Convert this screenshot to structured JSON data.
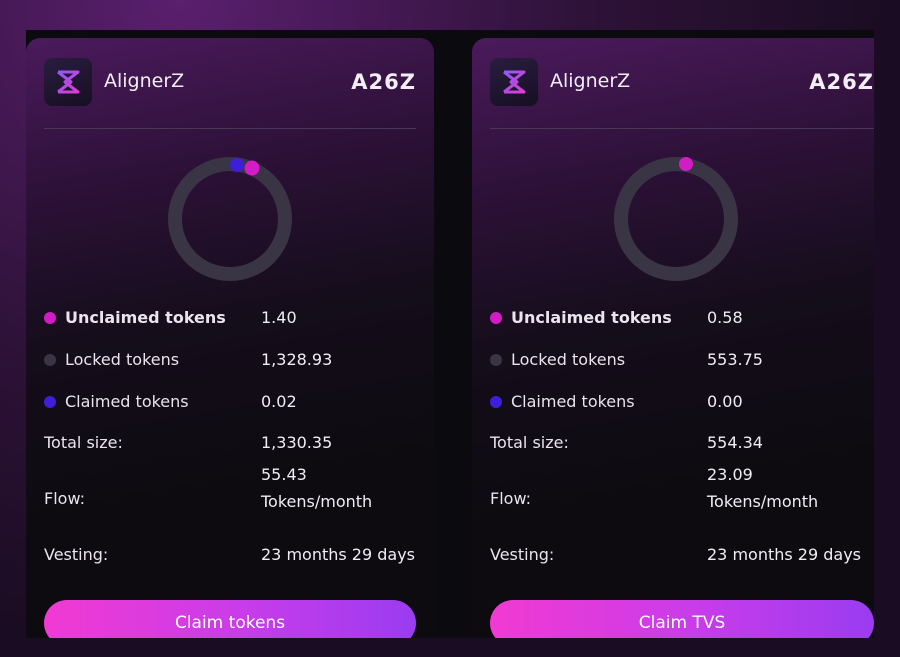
{
  "colors": {
    "unclaimed": "#d21cc6",
    "locked": "#3a3545",
    "claimed": "#3d1fd9"
  },
  "cards": [
    {
      "brand": "AlignerZ",
      "ticker": "A26Z",
      "chart": {
        "unclaimed_fraction": 0.01,
        "claimed_fraction": 0.005
      },
      "rows": {
        "unclaimed": {
          "label": "Unclaimed tokens",
          "value": "1.40"
        },
        "locked": {
          "label": "Locked tokens",
          "value": "1,328.93"
        },
        "claimed": {
          "label": "Claimed tokens",
          "value": "0.02"
        },
        "total": {
          "label": "Total size:",
          "value": "1,330.35"
        },
        "flow": {
          "label": "Flow:",
          "value1": "55.43",
          "value2": "Tokens/month"
        },
        "vesting": {
          "label": "Vesting:",
          "value": "23 months 29 days"
        }
      },
      "button": "Claim tokens"
    },
    {
      "brand": "AlignerZ",
      "ticker": "A26Z",
      "chart": {
        "unclaimed_fraction": 0.01,
        "claimed_fraction": 0.0
      },
      "rows": {
        "unclaimed": {
          "label": "Unclaimed tokens",
          "value": "0.58"
        },
        "locked": {
          "label": "Locked tokens",
          "value": "553.75"
        },
        "claimed": {
          "label": "Claimed tokens",
          "value": "0.00"
        },
        "total": {
          "label": "Total size:",
          "value": "554.34"
        },
        "flow": {
          "label": "Flow:",
          "value1": "23.09",
          "value2": "Tokens/month"
        },
        "vesting": {
          "label": "Vesting:",
          "value": "23 months 29 days"
        }
      },
      "button": "Claim TVS"
    }
  ]
}
